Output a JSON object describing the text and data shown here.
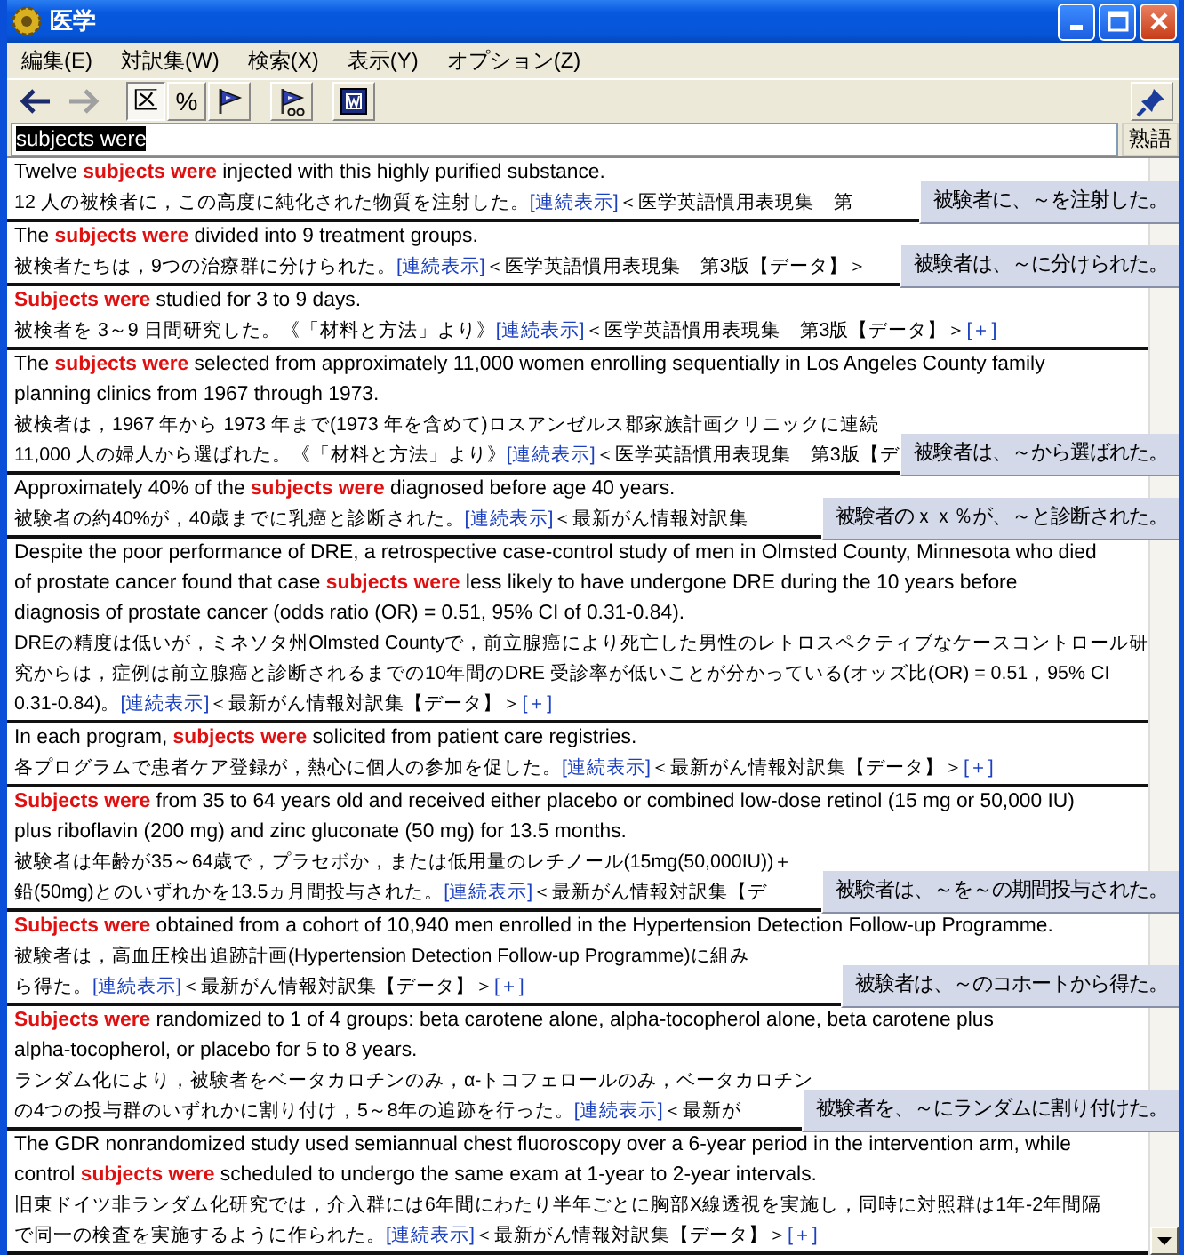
{
  "window": {
    "title": "医学"
  },
  "menu": [
    "編集(E)",
    "対訳集(W)",
    "検索(X)",
    "表示(Y)",
    "オプション(Z)"
  ],
  "toolbar": [
    {
      "kind": "back",
      "disabled": false
    },
    {
      "kind": "forward",
      "disabled": true
    },
    {
      "kind": "text",
      "label": "区",
      "pressed": true
    },
    {
      "kind": "text",
      "label": "%",
      "pressed": false
    },
    {
      "kind": "flag",
      "pressed": false
    },
    {
      "kind": "flag-glasses",
      "pressed": false
    },
    {
      "kind": "word",
      "pressed": false
    }
  ],
  "search": {
    "value": "subjects were",
    "button": "熟語"
  },
  "entries": [
    {
      "en": [
        [
          {
            "kind": "text",
            "text": "Twelve "
          },
          {
            "kind": "hit",
            "text": "subjects were"
          },
          {
            "kind": "text",
            "text": " injected with this highly purified substance."
          }
        ]
      ],
      "ja": [
        [
          {
            "kind": "text",
            "text": "12 人の被検者に，この高度に純化された物質を注射した。"
          },
          {
            "kind": "link",
            "text": "[連続表示]"
          },
          {
            "kind": "text",
            "text": "＜医学英語慣用表現集　第"
          }
        ]
      ],
      "tooltip": "被験者に、～を注射した。"
    },
    {
      "en": [
        [
          {
            "kind": "text",
            "text": "The "
          },
          {
            "kind": "hit",
            "text": "subjects were"
          },
          {
            "kind": "text",
            "text": " divided into 9 treatment groups."
          }
        ]
      ],
      "ja": [
        [
          {
            "kind": "text",
            "text": "被検者たちは，9つの治療群に分けられた。"
          },
          {
            "kind": "link",
            "text": "[連続表示]"
          },
          {
            "kind": "text",
            "text": "＜医学英語慣用表現集　第3版【データ】＞"
          }
        ]
      ],
      "tooltip": "被験者は、～に分けられた。"
    },
    {
      "en": [
        [
          {
            "kind": "hit",
            "text": "Subjects were"
          },
          {
            "kind": "text",
            "text": " studied for 3 to 9 days."
          }
        ]
      ],
      "ja": [
        [
          {
            "kind": "text",
            "text": "被検者を 3～9 日間研究した。《「材料と方法」より》"
          },
          {
            "kind": "link",
            "text": "[連続表示]"
          },
          {
            "kind": "text",
            "text": "＜医学英語慣用表現集　第3版【データ】＞"
          },
          {
            "kind": "link",
            "text": "[＋]"
          }
        ]
      ]
    },
    {
      "en": [
        [
          {
            "kind": "text",
            "text": "The "
          },
          {
            "kind": "hit",
            "text": "subjects were"
          },
          {
            "kind": "text",
            "text": " selected from approximately 11,000 women enrolling sequentially in Los Angeles County family"
          }
        ],
        [
          {
            "kind": "text",
            "text": "planning clinics from 1967 through 1973."
          }
        ]
      ],
      "ja": [
        [
          {
            "kind": "text",
            "text": "被検者は，1967 年から 1973 年まで(1973 年を含めて)ロスアンゼルス郡家族計画クリニックに連続"
          }
        ],
        [
          {
            "kind": "text",
            "text": "11,000 人の婦人から選ばれた。《「材料と方法」より》"
          },
          {
            "kind": "link",
            "text": "[連続表示]"
          },
          {
            "kind": "text",
            "text": "＜医学英語慣用表現集　第3版【デ"
          }
        ]
      ],
      "tooltip": "被験者は、～から選ばれた。"
    },
    {
      "en": [
        [
          {
            "kind": "text",
            "text": "Approximately 40% of the "
          },
          {
            "kind": "hit",
            "text": "subjects were"
          },
          {
            "kind": "text",
            "text": " diagnosed before age 40 years."
          }
        ]
      ],
      "ja": [
        [
          {
            "kind": "text",
            "text": "被験者の約40%が，40歳までに乳癌と診断された。 "
          },
          {
            "kind": "link",
            "text": "[連続表示]"
          },
          {
            "kind": "text",
            "text": "＜最新がん情報対訳集"
          }
        ]
      ],
      "tooltip": "被験者のｘｘ％が、～と診断された。"
    },
    {
      "en": [
        [
          {
            "kind": "text",
            "text": "Despite the poor performance of DRE, a retrospective case-control study of men in Olmsted County, Minnesota who died"
          }
        ],
        [
          {
            "kind": "text",
            "text": "of prostate cancer found that case "
          },
          {
            "kind": "hit",
            "text": "subjects were"
          },
          {
            "kind": "text",
            "text": " less likely to have undergone DRE during the 10 years before"
          }
        ],
        [
          {
            "kind": "text",
            "text": "diagnosis of prostate cancer (odds ratio (OR) = 0.51, 95% CI of 0.31-0.84)."
          }
        ]
      ],
      "ja": [
        [
          {
            "kind": "text",
            "text": "DREの精度は低いが，ミネソタ州Olmsted Countyで，前立腺癌により死亡した男性のレトロスペクティブなケースコントロール研"
          }
        ],
        [
          {
            "kind": "text",
            "text": "究からは，症例は前立腺癌と診断されるまでの10年間のDRE 受診率が低いことが分かっている(オッズ比(OR) = 0.51，95% CI"
          }
        ],
        [
          {
            "kind": "text",
            "text": "0.31-0.84)。"
          },
          {
            "kind": "link",
            "text": "[連続表示]"
          },
          {
            "kind": "text",
            "text": "＜最新がん情報対訳集【データ】＞"
          },
          {
            "kind": "link",
            "text": "[＋]"
          }
        ]
      ]
    },
    {
      "en": [
        [
          {
            "kind": "text",
            "text": "In each program, "
          },
          {
            "kind": "hit",
            "text": "subjects were"
          },
          {
            "kind": "text",
            "text": " solicited from patient care registries."
          }
        ]
      ],
      "ja": [
        [
          {
            "kind": "text",
            "text": "各プログラムで患者ケア登録が，熱心に個人の参加を促した。 "
          },
          {
            "kind": "link",
            "text": "[連続表示]"
          },
          {
            "kind": "text",
            "text": "＜最新がん情報対訳集【データ】＞"
          },
          {
            "kind": "link",
            "text": "[＋]"
          }
        ]
      ]
    },
    {
      "en": [
        [
          {
            "kind": "hit",
            "text": "Subjects were"
          },
          {
            "kind": "text",
            "text": " from 35 to 64 years old and received either placebo or combined low-dose retinol (15 mg or 50,000 IU)"
          }
        ],
        [
          {
            "kind": "text",
            "text": "plus riboflavin (200 mg) and zinc gluconate (50 mg) for 13.5 months."
          }
        ]
      ],
      "ja": [
        [
          {
            "kind": "text",
            "text": "被験者は年齢が35～64歳で，プラセボか，または低用量のレチノール(15mg(50,000IU))＋"
          }
        ],
        [
          {
            "kind": "text",
            "text": "鉛(50mg)とのいずれかを13.5ヵ月間投与された。"
          },
          {
            "kind": "link",
            "text": "[連続表示]"
          },
          {
            "kind": "text",
            "text": "＜最新がん情報対訳集【デ"
          }
        ]
      ],
      "tooltip": "被験者は、～を～の期間投与された。"
    },
    {
      "en": [
        [
          {
            "kind": "hit",
            "text": "Subjects were"
          },
          {
            "kind": "text",
            "text": " obtained from a cohort of 10,940 men enrolled in the Hypertension Detection Follow-up Programme."
          }
        ]
      ],
      "ja": [
        [
          {
            "kind": "text",
            "text": "被験者は，高血圧検出追跡計画(Hypertension Detection Follow-up Programme)に組み"
          }
        ],
        [
          {
            "kind": "text",
            "text": "ら得た。"
          },
          {
            "kind": "link",
            "text": "[連続表示]"
          },
          {
            "kind": "text",
            "text": "＜最新がん情報対訳集【データ】＞"
          },
          {
            "kind": "link",
            "text": "[＋]"
          }
        ]
      ],
      "tooltip": "被験者は、～のコホートから得た。"
    },
    {
      "en": [
        [
          {
            "kind": "hit",
            "text": "Subjects were"
          },
          {
            "kind": "text",
            "text": " randomized to 1 of 4 groups: beta carotene alone, alpha-tocopherol alone, beta carotene plus"
          }
        ],
        [
          {
            "kind": "text",
            "text": "alpha-tocopherol, or placebo for 5 to 8 years."
          }
        ]
      ],
      "ja": [
        [
          {
            "kind": "text",
            "text": "ランダム化により，被験者をベータカロチンのみ，α-トコフェロールのみ，ベータカロチン"
          }
        ],
        [
          {
            "kind": "text",
            "text": "の4つの投与群のいずれかに割り付け，5～8年の追跡を行った。"
          },
          {
            "kind": "link",
            "text": "[連続表示]"
          },
          {
            "kind": "text",
            "text": "＜最新が"
          }
        ]
      ],
      "tooltip": "被験者を、～にランダムに割り付けた。"
    },
    {
      "en": [
        [
          {
            "kind": "text",
            "text": "The GDR nonrandomized study used semiannual chest fluoroscopy over a 6-year period in the intervention arm, while"
          }
        ],
        [
          {
            "kind": "text",
            "text": "control "
          },
          {
            "kind": "hit",
            "text": "subjects were"
          },
          {
            "kind": "text",
            "text": " scheduled to undergo the same exam at 1-year to 2-year intervals."
          }
        ]
      ],
      "ja": [
        [
          {
            "kind": "text",
            "text": "旧東ドイツ非ランダム化研究では，介入群には6年間にわたり半年ごとに胸部X線透視を実施し，同時に対照群は1年-2年間隔"
          }
        ],
        [
          {
            "kind": "text",
            "text": "で同一の検査を実施するように作られた。"
          },
          {
            "kind": "link",
            "text": "[連続表示]"
          },
          {
            "kind": "text",
            "text": "＜最新がん情報対訳集【データ】＞"
          },
          {
            "kind": "link",
            "text": "[＋]"
          }
        ]
      ]
    }
  ]
}
